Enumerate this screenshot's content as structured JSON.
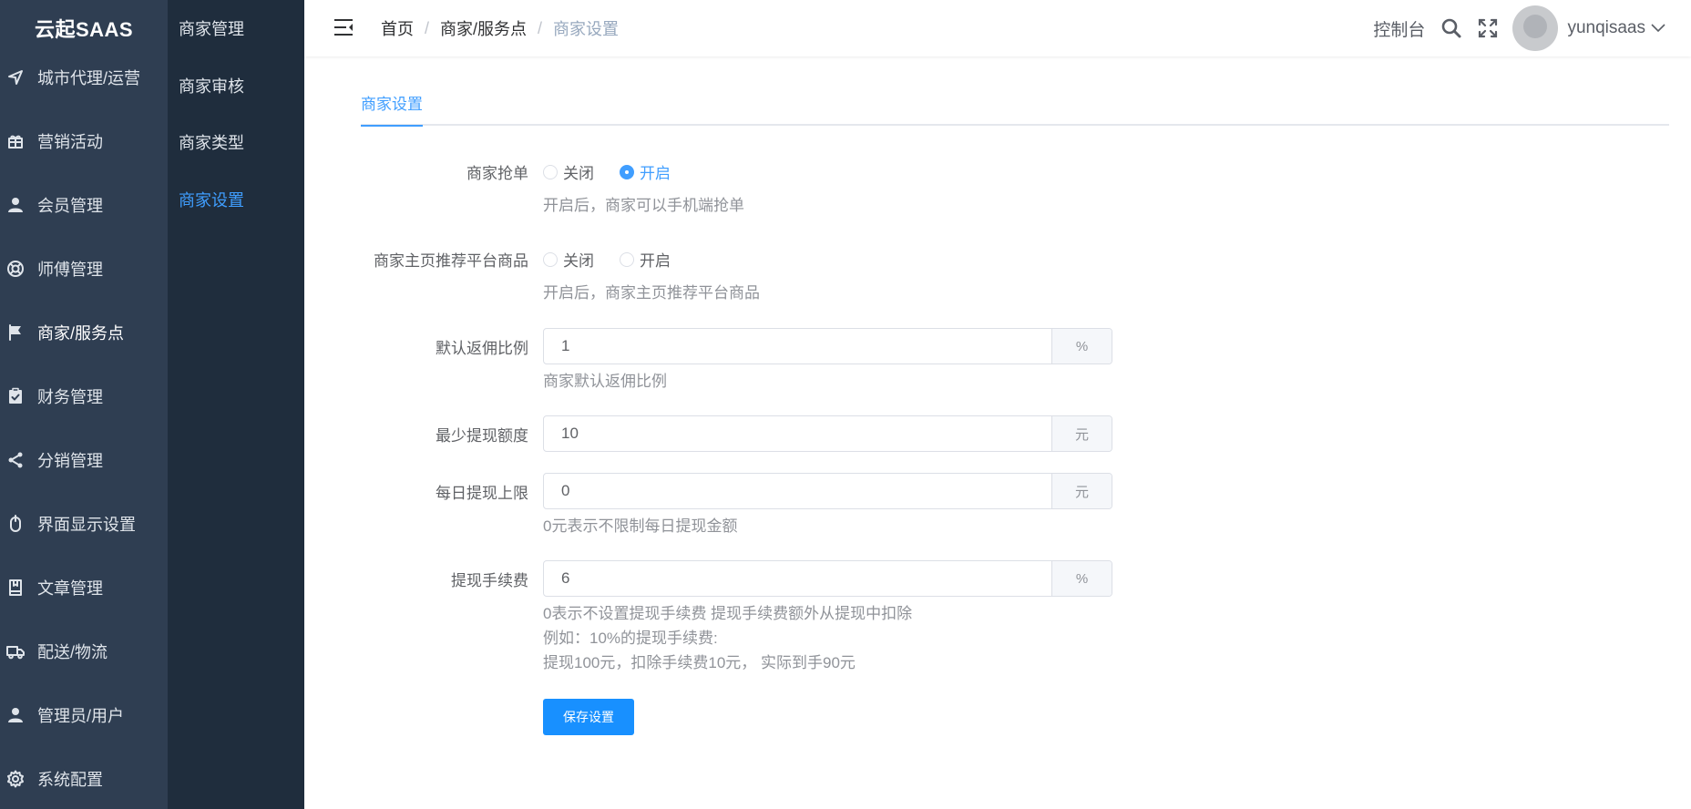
{
  "app": {
    "logo": "云起SAAS"
  },
  "sidebar": {
    "items": [
      {
        "label": "城市代理/运营"
      },
      {
        "label": "营销活动"
      },
      {
        "label": "会员管理"
      },
      {
        "label": "师傅管理"
      },
      {
        "label": "商家/服务点"
      },
      {
        "label": "财务管理"
      },
      {
        "label": "分销管理"
      },
      {
        "label": "界面显示设置"
      },
      {
        "label": "文章管理"
      },
      {
        "label": "配送/物流"
      },
      {
        "label": "管理员/用户"
      },
      {
        "label": "系统配置"
      }
    ],
    "active_index": 4
  },
  "subnav": {
    "items": [
      {
        "label": "商家管理"
      },
      {
        "label": "商家审核"
      },
      {
        "label": "商家类型"
      },
      {
        "label": "商家设置"
      }
    ],
    "active_index": 3
  },
  "header": {
    "breadcrumb": [
      "首页",
      "商家/服务点",
      "商家设置"
    ],
    "separator": "/",
    "console": "控制台",
    "username": "yunqisaas"
  },
  "tabs": [
    {
      "label": "商家设置"
    }
  ],
  "form": {
    "grab_order": {
      "label": "商家抢单",
      "options": [
        "关闭",
        "开启"
      ],
      "selected": "开启",
      "hint": "开启后，商家可以手机端抢单"
    },
    "recommend": {
      "label": "商家主页推荐平台商品",
      "options": [
        "关闭",
        "开启"
      ],
      "selected": "",
      "hint": "开启后，商家主页推荐平台商品"
    },
    "commission": {
      "label": "默认返佣比例",
      "value": "1",
      "suffix": "%",
      "hint": "商家默认返佣比例"
    },
    "min_withdraw": {
      "label": "最少提现额度",
      "value": "10",
      "suffix": "元"
    },
    "daily_limit": {
      "label": "每日提现上限",
      "value": "0",
      "suffix": "元",
      "hint": "0元表示不限制每日提现金额"
    },
    "fee": {
      "label": "提现手续费",
      "value": "6",
      "suffix": "%",
      "hints": [
        "0表示不设置提现手续费 提现手续费额外从提现中扣除",
        "例如：10%的提现手续费:",
        "提现100元，扣除手续费10元， 实际到手90元"
      ]
    },
    "save_label": "保存设置"
  },
  "colors": {
    "primary": "#409eff",
    "sidebar": "#2f3e52",
    "subnav": "#1f2d3d",
    "button": "#1890ff"
  }
}
